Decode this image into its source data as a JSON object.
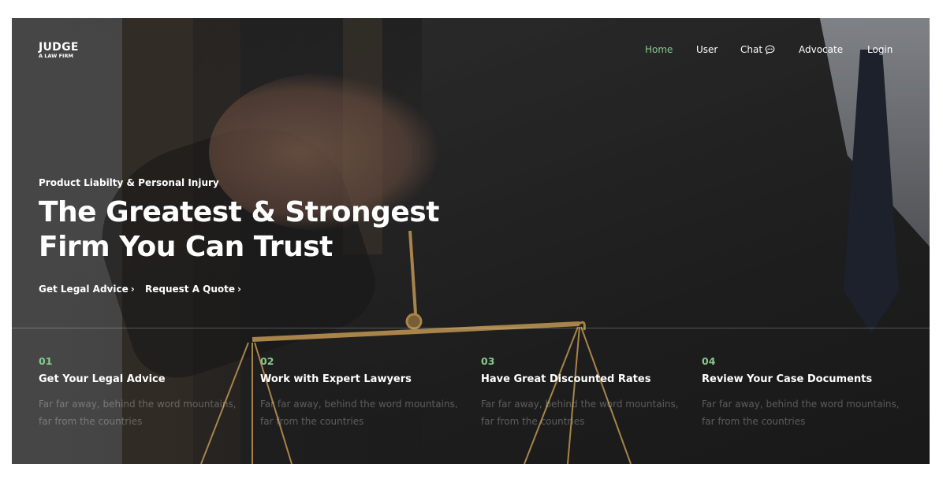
{
  "brand": {
    "name": "JUDGE",
    "tagline": "A LAW FIRM"
  },
  "nav": {
    "items": [
      {
        "label": "Home",
        "active": true
      },
      {
        "label": "User",
        "active": false
      },
      {
        "label": "Chat",
        "active": false,
        "icon": "chat-bubble-icon"
      },
      {
        "label": "Advocate",
        "active": false
      },
      {
        "label": "Login",
        "active": false
      }
    ]
  },
  "hero": {
    "kicker": "Product Liabilty & Personal Injury",
    "headline_line1": "The Greatest & Strongest",
    "headline_line2": "Firm You Can Trust",
    "cta_primary": "Get Legal Advice",
    "cta_secondary": "Request A Quote",
    "cta_chevron": "›"
  },
  "features": [
    {
      "number": "01",
      "title": "Get Your Legal Advice",
      "description": "Far far away, behind the word mountains, far from the countries"
    },
    {
      "number": "02",
      "title": "Work with Expert Lawyers",
      "description": "Far far away, behind the word mountains, far from the countries"
    },
    {
      "number": "03",
      "title": "Have Great Discounted Rates",
      "description": "Far far away, behind the word mountains, far from the countries"
    },
    {
      "number": "04",
      "title": "Review Your Case Documents",
      "description": "Far far away, behind the word mountains, far from the countries"
    }
  ],
  "colors": {
    "accent": "#86c98a",
    "text": "#ffffff",
    "white_bg": "#ffffff"
  }
}
